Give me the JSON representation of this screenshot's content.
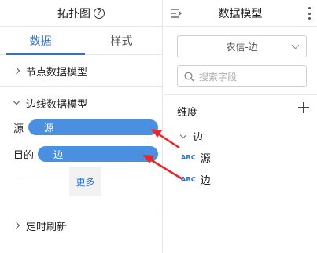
{
  "left_panel": {
    "title": "拓扑图",
    "tabs": [
      {
        "label": "数据"
      },
      {
        "label": "样式"
      }
    ],
    "node_section": {
      "label": "节点数据模型"
    },
    "edge_section": {
      "label": "边线数据模型",
      "source": {
        "label": "源",
        "value": "源"
      },
      "target": {
        "label": "目的",
        "value": "边"
      },
      "more_label": "更多"
    },
    "timer_section": {
      "label": "定时刷新"
    }
  },
  "right_panel": {
    "title": "数据模型",
    "select_value": "农信-边",
    "search_placeholder": "搜索字段",
    "dimension_label": "维度",
    "group": {
      "label": "边",
      "fields": [
        {
          "type": "ABC",
          "label": "源"
        },
        {
          "type": "ABC",
          "label": "边"
        }
      ]
    }
  },
  "colors": {
    "accent": "#2f6fd6",
    "pill": "#4a8fe0",
    "arrow": "#e8262c"
  }
}
